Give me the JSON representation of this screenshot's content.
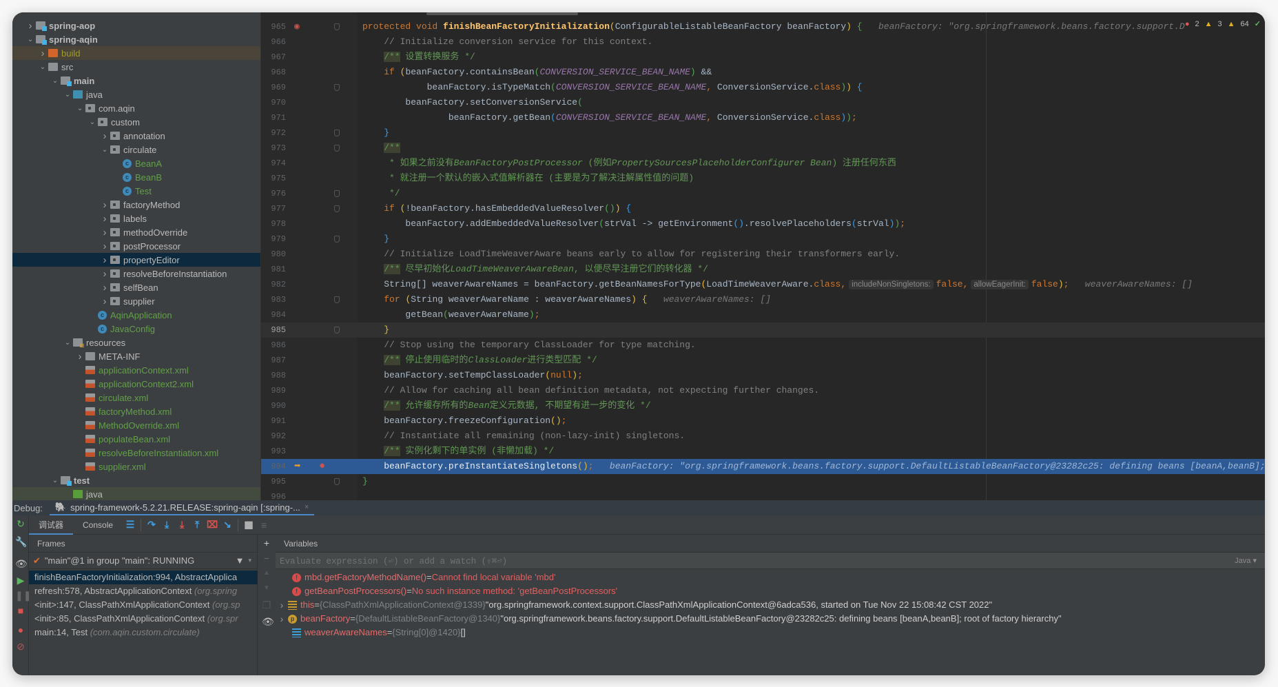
{
  "sidebar": {
    "tree": [
      {
        "label": "spring-aop",
        "depth": 0,
        "arrow": "closed",
        "icon": "module-folder",
        "bold": true
      },
      {
        "label": "spring-aqin",
        "depth": 0,
        "arrow": "open",
        "icon": "module-folder",
        "bold": true
      },
      {
        "label": "build",
        "depth": 1,
        "arrow": "closed",
        "icon": "excluded-folder",
        "color": "#a39b2c",
        "row": "#4a4538"
      },
      {
        "label": "src",
        "depth": 1,
        "arrow": "open",
        "icon": "folder"
      },
      {
        "label": "main",
        "depth": 2,
        "arrow": "open",
        "icon": "module-folder",
        "bold": true
      },
      {
        "label": "java",
        "depth": 3,
        "arrow": "open",
        "icon": "source-folder"
      },
      {
        "label": "com.aqin",
        "depth": 4,
        "arrow": "open",
        "icon": "package-folder"
      },
      {
        "label": "custom",
        "depth": 5,
        "arrow": "open",
        "icon": "package-folder"
      },
      {
        "label": "annotation",
        "depth": 6,
        "arrow": "closed",
        "icon": "package-folder"
      },
      {
        "label": "circulate",
        "depth": 6,
        "arrow": "open",
        "icon": "package-folder"
      },
      {
        "label": "BeanA",
        "depth": 7,
        "icon": "class",
        "color": "#62a048"
      },
      {
        "label": "BeanB",
        "depth": 7,
        "icon": "class",
        "color": "#62a048"
      },
      {
        "label": "Test",
        "depth": 7,
        "icon": "class",
        "color": "#62a048"
      },
      {
        "label": "factoryMethod",
        "depth": 6,
        "arrow": "closed",
        "icon": "package-folder"
      },
      {
        "label": "labels",
        "depth": 6,
        "arrow": "closed",
        "icon": "package-folder"
      },
      {
        "label": "methodOverride",
        "depth": 6,
        "arrow": "closed",
        "icon": "package-folder"
      },
      {
        "label": "postProcessor",
        "depth": 6,
        "arrow": "closed",
        "icon": "package-folder"
      },
      {
        "label": "propertyEditor",
        "depth": 6,
        "arrow": "closed",
        "icon": "package-folder",
        "row": "#0d293e"
      },
      {
        "label": "resolveBeforeInstantiation",
        "depth": 6,
        "arrow": "closed",
        "icon": "package-folder"
      },
      {
        "label": "selfBean",
        "depth": 6,
        "arrow": "closed",
        "icon": "package-folder"
      },
      {
        "label": "supplier",
        "depth": 6,
        "arrow": "closed",
        "icon": "package-folder"
      },
      {
        "label": "AqinApplication",
        "depth": 5,
        "icon": "class",
        "color": "#62a048"
      },
      {
        "label": "JavaConfig",
        "depth": 5,
        "icon": "class",
        "color": "#62a048"
      },
      {
        "label": "resources",
        "depth": 3,
        "arrow": "open",
        "icon": "resources-folder"
      },
      {
        "label": "META-INF",
        "depth": 4,
        "arrow": "closed",
        "icon": "folder"
      },
      {
        "label": "applicationContext.xml",
        "depth": 4,
        "icon": "spring-xml",
        "color": "#62a048"
      },
      {
        "label": "applicationContext2.xml",
        "depth": 4,
        "icon": "spring-xml",
        "color": "#62a048"
      },
      {
        "label": "circulate.xml",
        "depth": 4,
        "icon": "spring-xml",
        "color": "#62a048"
      },
      {
        "label": "factoryMethod.xml",
        "depth": 4,
        "icon": "spring-xml",
        "color": "#62a048"
      },
      {
        "label": "MethodOverride.xml",
        "depth": 4,
        "icon": "spring-xml",
        "color": "#62a048"
      },
      {
        "label": "populateBean.xml",
        "depth": 4,
        "icon": "spring-xml",
        "color": "#62a048"
      },
      {
        "label": "resolveBeforeInstantiation.xml",
        "depth": 4,
        "icon": "spring-xml",
        "color": "#62a048"
      },
      {
        "label": "supplier.xml",
        "depth": 4,
        "icon": "spring-xml",
        "color": "#62a048"
      },
      {
        "label": "test",
        "depth": 2,
        "arrow": "open",
        "icon": "module-folder",
        "bold": true
      },
      {
        "label": "java",
        "depth": 3,
        "icon": "test-source-folder",
        "row": "#434a3e"
      }
    ]
  },
  "editor": {
    "inspections": {
      "errors": "2",
      "warnings": "3",
      "weak_warnings": "64"
    },
    "current_line": 985,
    "execution_line": 994,
    "breakpoint_lines": [
      994
    ],
    "method_breakpoint_lines": [
      965
    ],
    "lines": [
      {
        "n": "965",
        "tk": [
          [
            "kw",
            "protected void "
          ],
          [
            "fn",
            "finishBeanFactoryInitialization"
          ],
          [
            "b1",
            "("
          ],
          [
            "t",
            "ConfigurableListableBeanFactory beanFactory"
          ],
          [
            "b1",
            ")"
          ],
          [
            "t",
            " "
          ],
          [
            "b2",
            "{"
          ],
          [
            "h",
            "   beanFactory: \"org.springframework.beans.factory.support.D"
          ]
        ]
      },
      {
        "n": "966",
        "tk": [
          [
            "cm",
            "    // Initialize conversion service for this context."
          ]
        ]
      },
      {
        "n": "967",
        "tk": [
          [
            "t",
            "    "
          ],
          [
            "dm",
            "/**"
          ],
          [
            "doc",
            " 设置转换服务 */"
          ]
        ]
      },
      {
        "n": "968",
        "tk": [
          [
            "t",
            "    "
          ],
          [
            "kw",
            "if "
          ],
          [
            "b1",
            "("
          ],
          [
            "t",
            "beanFactory.containsBean"
          ],
          [
            "b2",
            "("
          ],
          [
            "cs",
            "CONVERSION_SERVICE_BEAN_NAME"
          ],
          [
            "b2",
            ")"
          ],
          [
            "t",
            " &&"
          ]
        ]
      },
      {
        "n": "969",
        "tk": [
          [
            "t",
            "            beanFactory.isTypeMatch"
          ],
          [
            "b2",
            "("
          ],
          [
            "cs",
            "CONVERSION_SERVICE_BEAN_NAME"
          ],
          [
            "kw",
            ","
          ],
          [
            "t",
            " ConversionService."
          ],
          [
            "kw",
            "class"
          ],
          [
            "b2",
            ")"
          ],
          [
            "b1",
            ")"
          ],
          [
            "t",
            " "
          ],
          [
            "b3",
            "{"
          ]
        ]
      },
      {
        "n": "970",
        "tk": [
          [
            "t",
            "        beanFactory.setConversionService"
          ],
          [
            "b2",
            "("
          ]
        ]
      },
      {
        "n": "971",
        "tk": [
          [
            "t",
            "                beanFactory.getBean"
          ],
          [
            "b3",
            "("
          ],
          [
            "cs",
            "CONVERSION_SERVICE_BEAN_NAME"
          ],
          [
            "kw",
            ","
          ],
          [
            "t",
            " ConversionService."
          ],
          [
            "kw",
            "class"
          ],
          [
            "b3",
            ")"
          ],
          [
            "b2",
            ")"
          ],
          [
            "kw",
            ";"
          ]
        ]
      },
      {
        "n": "972",
        "tk": [
          [
            "t",
            "    "
          ],
          [
            "b3",
            "}"
          ]
        ]
      },
      {
        "n": "973",
        "tk": [
          [
            "t",
            "    "
          ],
          [
            "dm",
            "/**"
          ]
        ]
      },
      {
        "n": "974",
        "tk": [
          [
            "doc",
            "     * 如果之前没有"
          ],
          [
            "di",
            "BeanFactoryPostProcessor"
          ],
          [
            "doc",
            " (例如"
          ],
          [
            "di",
            "PropertySourcesPlaceholderConfigurer Bean"
          ],
          [
            "doc",
            ") 注册任何东西"
          ]
        ]
      },
      {
        "n": "975",
        "tk": [
          [
            "doc",
            "     * 就注册一个默认的嵌入式值解析器在 (主要是为了解决注解属性值的问题)"
          ]
        ]
      },
      {
        "n": "976",
        "tk": [
          [
            "doc",
            "     */"
          ]
        ]
      },
      {
        "n": "977",
        "tk": [
          [
            "t",
            "    "
          ],
          [
            "kw",
            "if "
          ],
          [
            "b1",
            "("
          ],
          [
            "t",
            "!beanFactory.hasEmbeddedValueResolver"
          ],
          [
            "b2",
            "()"
          ],
          [
            "b1",
            ")"
          ],
          [
            "t",
            " "
          ],
          [
            "b3",
            "{"
          ]
        ]
      },
      {
        "n": "978",
        "tk": [
          [
            "t",
            "        beanFactory.addEmbeddedValueResolver"
          ],
          [
            "b2",
            "("
          ],
          [
            "t",
            "strVal -> getEnvironment"
          ],
          [
            "b3",
            "()"
          ],
          [
            "t",
            ".resolvePlaceholders"
          ],
          [
            "b3",
            "("
          ],
          [
            "t",
            "strVal"
          ],
          [
            "b3",
            ")"
          ],
          [
            "b2",
            ")"
          ],
          [
            "kw",
            ";"
          ]
        ]
      },
      {
        "n": "979",
        "tk": [
          [
            "t",
            "    "
          ],
          [
            "b3",
            "}"
          ]
        ]
      },
      {
        "n": "980",
        "tk": [
          [
            "cm",
            "    // Initialize LoadTimeWeaverAware beans early to allow for registering their transformers early."
          ]
        ]
      },
      {
        "n": "981",
        "tk": [
          [
            "t",
            "    "
          ],
          [
            "dm",
            "/**"
          ],
          [
            "doc",
            " 尽早初始化"
          ],
          [
            "di",
            "LoadTimeWeaverAwareBean"
          ],
          [
            "doc",
            ", 以便尽早注册它们的转化器 */"
          ]
        ]
      },
      {
        "n": "982",
        "tk": [
          [
            "t",
            "    String[] weaverAwareNames = beanFactory.getBeanNamesForType"
          ],
          [
            "b1",
            "("
          ],
          [
            "t",
            "LoadTimeWeaverAware."
          ],
          [
            "kw",
            "class,"
          ],
          [
            "ch",
            "includeNonSingletons:"
          ],
          [
            "kw",
            "false,"
          ],
          [
            "ch",
            "allowEagerInit:"
          ],
          [
            "kw",
            "false"
          ],
          [
            "b1",
            ")"
          ],
          [
            "kw",
            ";"
          ],
          [
            "h",
            "   weaverAwareNames: []"
          ]
        ]
      },
      {
        "n": "983",
        "tk": [
          [
            "t",
            "    "
          ],
          [
            "kw",
            "for "
          ],
          [
            "b1",
            "("
          ],
          [
            "t",
            "String weaverAwareName : weaverAwareNames"
          ],
          [
            "b1",
            ")"
          ],
          [
            "t",
            " "
          ],
          [
            "b1",
            "{"
          ],
          [
            "h",
            "   weaverAwareNames: []"
          ]
        ]
      },
      {
        "n": "984",
        "tk": [
          [
            "t",
            "        getBean"
          ],
          [
            "b2",
            "("
          ],
          [
            "t",
            "weaverAwareName"
          ],
          [
            "b2",
            ")"
          ],
          [
            "kw",
            ";"
          ]
        ]
      },
      {
        "n": "985",
        "tk": [
          [
            "t",
            "    "
          ],
          [
            "b1",
            "}"
          ]
        ]
      },
      {
        "n": "986",
        "tk": [
          [
            "cm",
            "    // Stop using the temporary ClassLoader for type matching."
          ]
        ]
      },
      {
        "n": "987",
        "tk": [
          [
            "t",
            "    "
          ],
          [
            "dm",
            "/**"
          ],
          [
            "doc",
            " 停止使用临时的"
          ],
          [
            "di",
            "ClassLoader"
          ],
          [
            "doc",
            "进行类型匹配 */"
          ]
        ]
      },
      {
        "n": "988",
        "tk": [
          [
            "t",
            "    beanFactory.setTempClassLoader"
          ],
          [
            "b1",
            "("
          ],
          [
            "kw",
            "null"
          ],
          [
            "b1",
            ")"
          ],
          [
            "kw",
            ";"
          ]
        ]
      },
      {
        "n": "989",
        "tk": [
          [
            "cm",
            "    // Allow for caching all bean definition metadata, not expecting further changes."
          ]
        ]
      },
      {
        "n": "990",
        "tk": [
          [
            "t",
            "    "
          ],
          [
            "dm",
            "/**"
          ],
          [
            "doc",
            " 允许缓存所有的"
          ],
          [
            "di",
            "Bean"
          ],
          [
            "doc",
            "定义元数据, 不期望有进一步的变化 */"
          ]
        ]
      },
      {
        "n": "991",
        "tk": [
          [
            "t",
            "    beanFactory.freezeConfiguration"
          ],
          [
            "b1",
            "()"
          ],
          [
            "kw",
            ";"
          ]
        ]
      },
      {
        "n": "992",
        "tk": [
          [
            "cm",
            "    // Instantiate all remaining (non-lazy-init) singletons."
          ]
        ]
      },
      {
        "n": "993",
        "tk": [
          [
            "t",
            "    "
          ],
          [
            "dm",
            "/**"
          ],
          [
            "doc",
            " 实例化剩下的单实例 (非懒加载) */"
          ]
        ]
      },
      {
        "n": "994",
        "tk": [
          [
            "t",
            "    beanFactory.preInstantiateSingletons"
          ],
          [
            "b1",
            "()"
          ],
          [
            "kw",
            ";"
          ],
          [
            "h",
            "   beanFactory: \"org.springframework.beans.factory.support.DefaultListableBeanFactory@23282c25: defining beans [beanA,beanB];"
          ]
        ]
      },
      {
        "n": "995",
        "tk": [
          [
            "b2",
            "}"
          ]
        ]
      },
      {
        "n": "996",
        "tk": []
      }
    ]
  },
  "debug": {
    "label": "Debug:",
    "session_tab": "spring-framework-5.2.21.RELEASE:spring-aqin [:spring-...",
    "close": "×",
    "tabs": [
      "调试器",
      "Console"
    ],
    "frames_header": "Frames",
    "variables_header": "Variables",
    "thread": "\"main\"@1 in group \"main\": RUNNING",
    "frames": [
      {
        "name": "finishBeanFactoryInitialization:994, AbstractApplica",
        "pkg": ""
      },
      {
        "name": "refresh:578, AbstractApplicationContext ",
        "pkg": "(org.spring"
      },
      {
        "name": "<init>:147, ClassPathXmlApplicationContext ",
        "pkg": "(org.sp"
      },
      {
        "name": "<init>:85, ClassPathXmlApplicationContext ",
        "pkg": "(org.spr"
      },
      {
        "name": "main:14, Test ",
        "pkg": "(com.aqin.custom.circulate)"
      }
    ],
    "eval_placeholder": "Evaluate expression (⏎) or add a watch (⇧⌘⏎)",
    "language": "Java",
    "variables": [
      {
        "icon": "error",
        "name": "mbd.getFactoryMethodName()",
        "eq": " = ",
        "error": "Cannot find local variable 'mbd'"
      },
      {
        "icon": "error",
        "name": "getBeanPostProcessors()",
        "eq": " = ",
        "error": "No such instance method: 'getBeanPostProcessors'"
      },
      {
        "icon": "object",
        "expandable": true,
        "name": "this",
        "eq": " = ",
        "type": "{ClassPathXmlApplicationContext@1339} ",
        "value": "\"org.springframework.context.support.ClassPathXmlApplicationContext@6adca536, started on Tue Nov 22 15:08:42 CST 2022\""
      },
      {
        "icon": "parameter",
        "expandable": true,
        "name": "beanFactory",
        "eq": " = ",
        "type": "{DefaultListableBeanFactory@1340} ",
        "value": "\"org.springframework.beans.factory.support.DefaultListableBeanFactory@23282c25: defining beans [beanA,beanB]; root of factory hierarchy\""
      },
      {
        "icon": "array",
        "name": "weaverAwareNames",
        "eq": " = ",
        "type": "{String[0]@1420} ",
        "value": "[]"
      }
    ]
  }
}
